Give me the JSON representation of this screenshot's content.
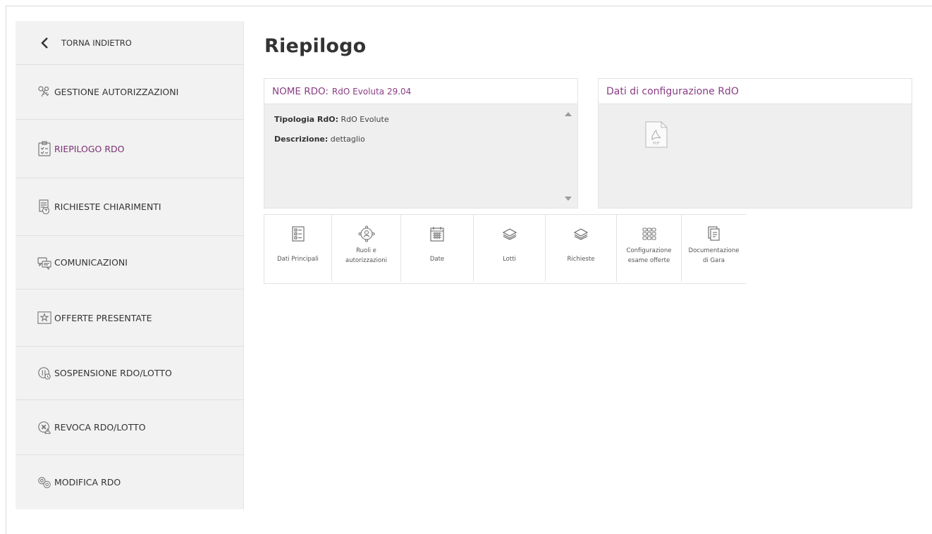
{
  "sidebar": {
    "back_label": "TORNA INDIETRO",
    "items": [
      {
        "label": "GESTIONE AUTORIZZAZIONI",
        "icon": "keys-icon"
      },
      {
        "label": "RIEPILOGO RDO",
        "icon": "clipboard-icon",
        "active": true
      },
      {
        "label": "RICHIESTE CHIARIMENTI",
        "icon": "document-question-icon"
      },
      {
        "label": "COMUNICAZIONI",
        "icon": "chat-icon"
      },
      {
        "label": "OFFERTE PRESENTATE",
        "icon": "star-frame-icon"
      },
      {
        "label": "SOSPENSIONE RDO/LOTTO",
        "icon": "pause-icon"
      },
      {
        "label": "REVOCA RDO/LOTTO",
        "icon": "cancel-icon"
      },
      {
        "label": "MODIFICA RDO",
        "icon": "gears-icon"
      }
    ]
  },
  "main": {
    "title": "Riepilogo",
    "rdo_card": {
      "label": "NOME RDO:",
      "name": "RdO Evoluta 29.04",
      "tipologia_label": "Tipologia RdO:",
      "tipologia_value": "RdO Evolute",
      "descrizione_label": "Descrizione:",
      "descrizione_value": "dettaglio"
    },
    "config_card": {
      "title": "Dati di configurazione RdO",
      "pdf_text": "PDF"
    },
    "tabs": [
      {
        "label": "Dati Principali",
        "icon": "list-icon"
      },
      {
        "label_1": "Ruoli e",
        "label_2": "autorizzazioni",
        "icon": "user-roles-icon"
      },
      {
        "label": "Date",
        "icon": "calendar-icon"
      },
      {
        "label": "Lotti",
        "icon": "layers-icon"
      },
      {
        "label": "Richieste",
        "icon": "layers-icon"
      },
      {
        "label_1": "Configurazione",
        "label_2": "esame offerte",
        "icon": "grid-icon"
      },
      {
        "label_1": "Documentazione",
        "label_2": "di Gara",
        "icon": "documents-icon"
      }
    ]
  },
  "colors": {
    "accent": "#8a3d84",
    "sidebar_bg": "#f2f2f2",
    "panel_bg": "#efefef"
  }
}
